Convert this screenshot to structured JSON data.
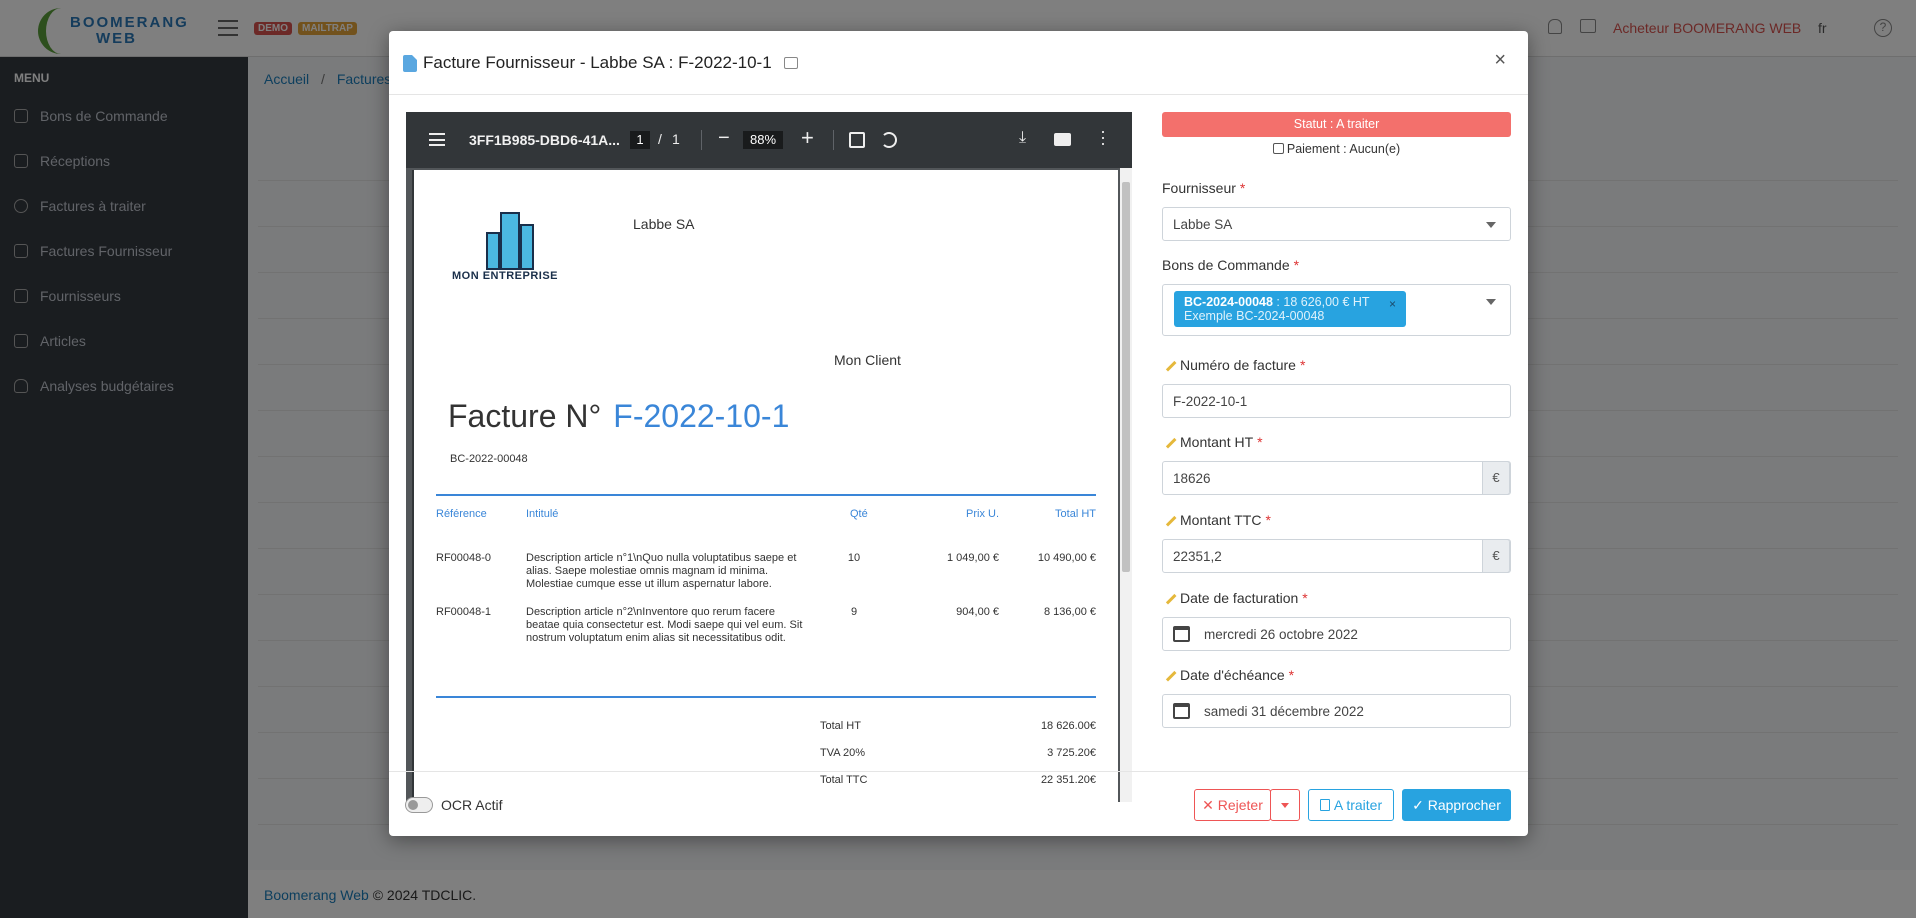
{
  "app": {
    "logo_line1": "BOOMERANG",
    "logo_line2": "WEB",
    "badges": [
      "DEMO",
      "MAILTRAP"
    ],
    "user": "Acheteur BOOMERANG WEB",
    "lang": "fr",
    "help": "?"
  },
  "sidebar": {
    "title": "MENU",
    "items": [
      {
        "label": "Bons de Commande",
        "icon": "document-icon"
      },
      {
        "label": "Réceptions",
        "icon": "truck-icon"
      },
      {
        "label": "Factures à traiter",
        "icon": "cloud-icon"
      },
      {
        "label": "Factures Fournisseur",
        "icon": "invoice-icon"
      },
      {
        "label": "Fournisseurs",
        "icon": "factory-icon"
      },
      {
        "label": "Articles",
        "icon": "books-icon"
      },
      {
        "label": "Analyses budgétaires",
        "icon": "flask-icon"
      }
    ]
  },
  "breadcrumb": {
    "home": "Accueil",
    "sep": "/",
    "current": "Factures F"
  },
  "footer": {
    "link": "Boomerang Web",
    "text": "© 2024 TDCLIC."
  },
  "modal": {
    "title": "Facture Fournisseur - Labbe SA : F-2022-10-1",
    "close": "×"
  },
  "pdf": {
    "filename": "3FF1B985-DBD6-41A...",
    "page": "1",
    "page_sep": "/",
    "page_total": "1",
    "zoom": "88%",
    "minus": "−",
    "plus": "+",
    "logo_text": "MON ENTREPRISE",
    "supplier": "Labbe SA",
    "client": "Mon Client",
    "title_prefix": "Facture N°",
    "invoice_number": "F-2022-10-1",
    "order_ref": "BC-2022-00048",
    "headers": {
      "ref": "Référence",
      "label": "Intitulé",
      "qty": "Qté",
      "price": "Prix U.",
      "total": "Total HT"
    },
    "lines": [
      {
        "ref": "RF00048-0",
        "label": "Description article n°1\\nQuo nulla voluptatibus saepe et alias. Saepe molestiae omnis magnam id minima. Molestiae cumque esse ut illum aspernatur labore.",
        "qty": "10",
        "price": "1 049,00 €",
        "total": "10 490,00 €"
      },
      {
        "ref": "RF00048-1",
        "label": "Description article n°2\\nInventore quo rerum facere beatae quia consectetur est. Modi saepe qui vel eum. Sit nostrum voluptatum enim alias sit necessitatibus odit.",
        "qty": "9",
        "price": "904,00 €",
        "total": "8 136,00 €"
      }
    ],
    "totals": [
      {
        "label": "Total HT",
        "value": "18 626.00€"
      },
      {
        "label": "TVA 20%",
        "value": "3 725.20€"
      },
      {
        "label": "Total TTC",
        "value": "22 351.20€"
      }
    ]
  },
  "form": {
    "status": "Statut : A traiter",
    "payment": "Paiement : Aucun(e)",
    "supplier_label": "Fournisseur",
    "supplier_value": "Labbe SA",
    "orders_label": "Bons de Commande",
    "order_tag_code": "BC-2024-00048",
    "order_tag_amount": " : 18 626,00 € HT",
    "order_tag_desc": "Exemple BC-2024-00048",
    "order_tag_remove": "×",
    "invoice_number_label": "Numéro de facture",
    "invoice_number_value": "F-2022-10-1",
    "amount_ht_label": "Montant HT",
    "amount_ht_value": "18626",
    "amount_ttc_label": "Montant TTC",
    "amount_ttc_value": "22351,2",
    "currency": "€",
    "invoice_date_label": "Date de facturation",
    "invoice_date_value": "mercredi 26 octobre 2022",
    "due_date_label": "Date d'échéance",
    "due_date_value": "samedi 31 décembre 2022",
    "required": "*"
  },
  "actions": {
    "ocr_label": "OCR Actif",
    "reject": "✕ Rejeter",
    "todo": "A traiter",
    "match": "✓ Rapprocher"
  },
  "colors": {
    "accent": "#28a3e0",
    "status": "#f3706c",
    "danger": "#e55555",
    "sidebar": "#343a40"
  }
}
